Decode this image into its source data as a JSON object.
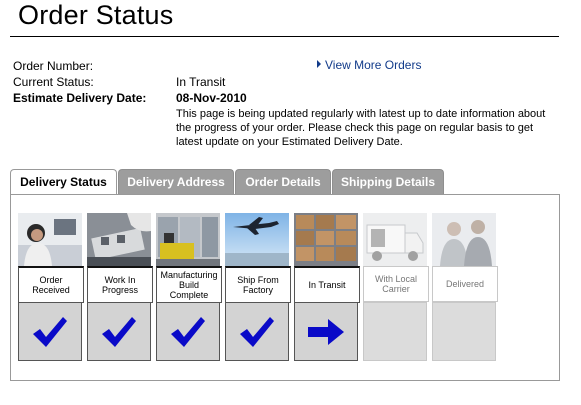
{
  "page": {
    "title": "Order Status"
  },
  "order": {
    "number_label": "Order Number:",
    "status_label": "Current Status:",
    "status_value": "In Transit",
    "delivery_label": "Estimate Delivery Date:",
    "delivery_value": "08-Nov-2010",
    "description": "This page is being updated regularly with latest up to date information about the progress of your order. Please check this page on regular basis to get latest update on your Estimated Delivery Date.",
    "more_link": "View More Orders"
  },
  "tabs": [
    {
      "label": "Delivery Status",
      "active": true
    },
    {
      "label": "Delivery Address",
      "active": false
    },
    {
      "label": "Order Details",
      "active": false
    },
    {
      "label": "Shipping Details",
      "active": false
    }
  ],
  "steps": [
    {
      "line1": "Order",
      "line2": "Received",
      "line3": "",
      "state": "done",
      "mark": "check-icon"
    },
    {
      "line1": "Work In",
      "line2": "Progress",
      "line3": "",
      "state": "done",
      "mark": "check-icon"
    },
    {
      "line1": "Manufacturing",
      "line2": "Build",
      "line3": "Complete",
      "state": "done",
      "mark": "check-icon"
    },
    {
      "line1": "Ship From",
      "line2": "Factory",
      "line3": "",
      "state": "done",
      "mark": "check-icon"
    },
    {
      "line1": "In Transit",
      "line2": "",
      "line3": "",
      "state": "current",
      "mark": "arrow-right-icon"
    },
    {
      "line1": "With Local",
      "line2": "Carrier",
      "line3": "",
      "state": "pending",
      "mark": ""
    },
    {
      "line1": "Delivered",
      "line2": "",
      "line3": "",
      "state": "pending",
      "mark": ""
    }
  ],
  "colors": {
    "accent": "#0a0ac8",
    "link": "#123b8a",
    "tab_inactive": "#9d9d9d"
  }
}
